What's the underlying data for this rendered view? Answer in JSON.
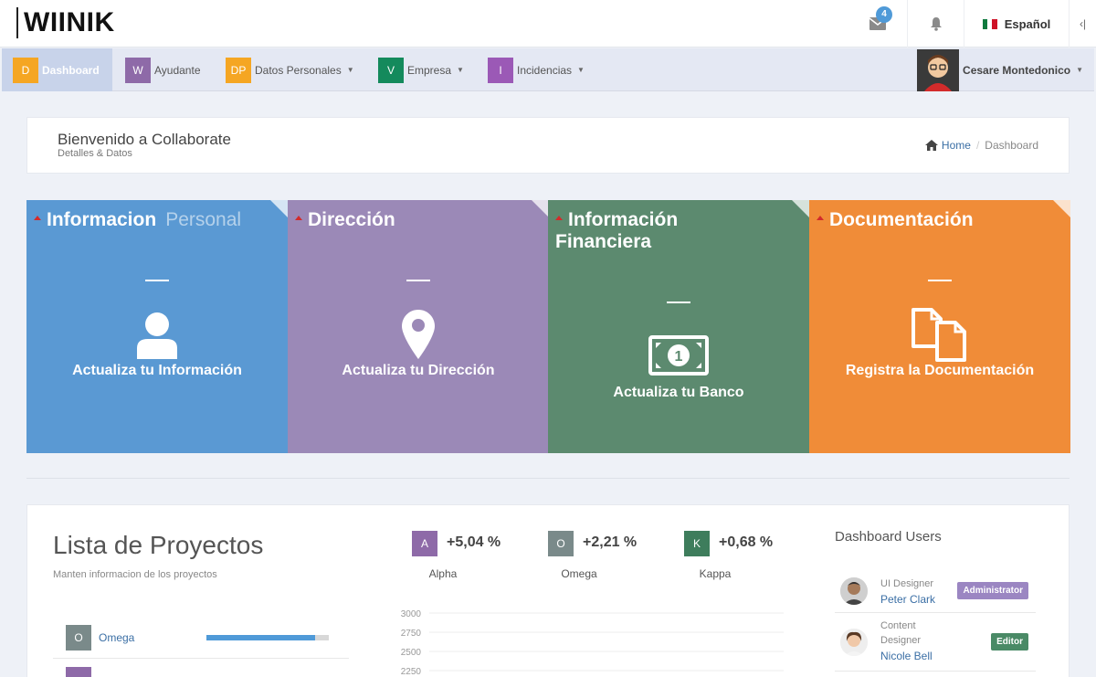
{
  "header": {
    "logo": "WIINIK",
    "mail_count": "4",
    "language": "Español",
    "collapse_icon": "‹|"
  },
  "nav": {
    "items": [
      {
        "letter": "D",
        "label": "Dashboard",
        "color": "#f5a623",
        "active": true
      },
      {
        "letter": "W",
        "label": "Ayudante",
        "color": "#8e6aa8"
      },
      {
        "letter": "DP",
        "label": "Datos Personales",
        "color": "#f5a623",
        "dropdown": true
      },
      {
        "letter": "V",
        "label": "Empresa",
        "color": "#148a5c",
        "dropdown": true
      },
      {
        "letter": "I",
        "label": "Incidencias",
        "color": "#9b59b6",
        "dropdown": true
      }
    ],
    "user_name": "Cesare Montedonico"
  },
  "welcome": {
    "title": "Bienvenido a Collaborate",
    "subtitle": "Detalles & Datos",
    "breadcrumb_home": "Home",
    "breadcrumb_current": "Dashboard"
  },
  "tiles": [
    {
      "title": "Informacion",
      "title_muted": "Personal",
      "cta": "Actualiza tu Información",
      "color": "#5a99d3",
      "icon": "user-icon"
    },
    {
      "title": "Dirección",
      "cta": "Actualiza tu Dirección",
      "color": "#9b89b7",
      "icon": "map-marker-icon"
    },
    {
      "title": "Información",
      "title2": "Financiera",
      "cta": "Actualiza tu Banco",
      "color": "#5c8a6f",
      "icon": "money-icon"
    },
    {
      "title": "Documentación",
      "cta": "Registra la Documentación",
      "color": "#f08c38",
      "icon": "documents-icon"
    }
  ],
  "projects": {
    "title": "Lista de Proyectos",
    "subtitle": "Manten informacion de los proyectos",
    "rows": [
      {
        "letter": "O",
        "name": "Omega",
        "color": "#7a8a8a",
        "progress": 0.89
      }
    ]
  },
  "stats": [
    {
      "letter": "A",
      "value": "+5,04 %",
      "label": "Alpha",
      "color": "#8e6aa8"
    },
    {
      "letter": "O",
      "value": "+2,21 %",
      "label": "Omega",
      "color": "#7a8a8a"
    },
    {
      "letter": "K",
      "value": "+0,68 %",
      "label": "Kappa",
      "color": "#3e7d5c"
    }
  ],
  "chart_data": {
    "type": "line",
    "y_ticks": [
      "3000",
      "2750",
      "2500",
      "2250"
    ]
  },
  "users": {
    "title": "Dashboard Users",
    "list": [
      {
        "role": "UI Designer",
        "name": "Peter Clark",
        "badge": "Administrator",
        "badge_color": "#9b86c2"
      },
      {
        "role": "Content Designer",
        "role_line1": "Content",
        "role_line2": "Designer",
        "name": "Nicole Bell",
        "badge": "Editor",
        "badge_color": "#4a8a66"
      }
    ]
  }
}
